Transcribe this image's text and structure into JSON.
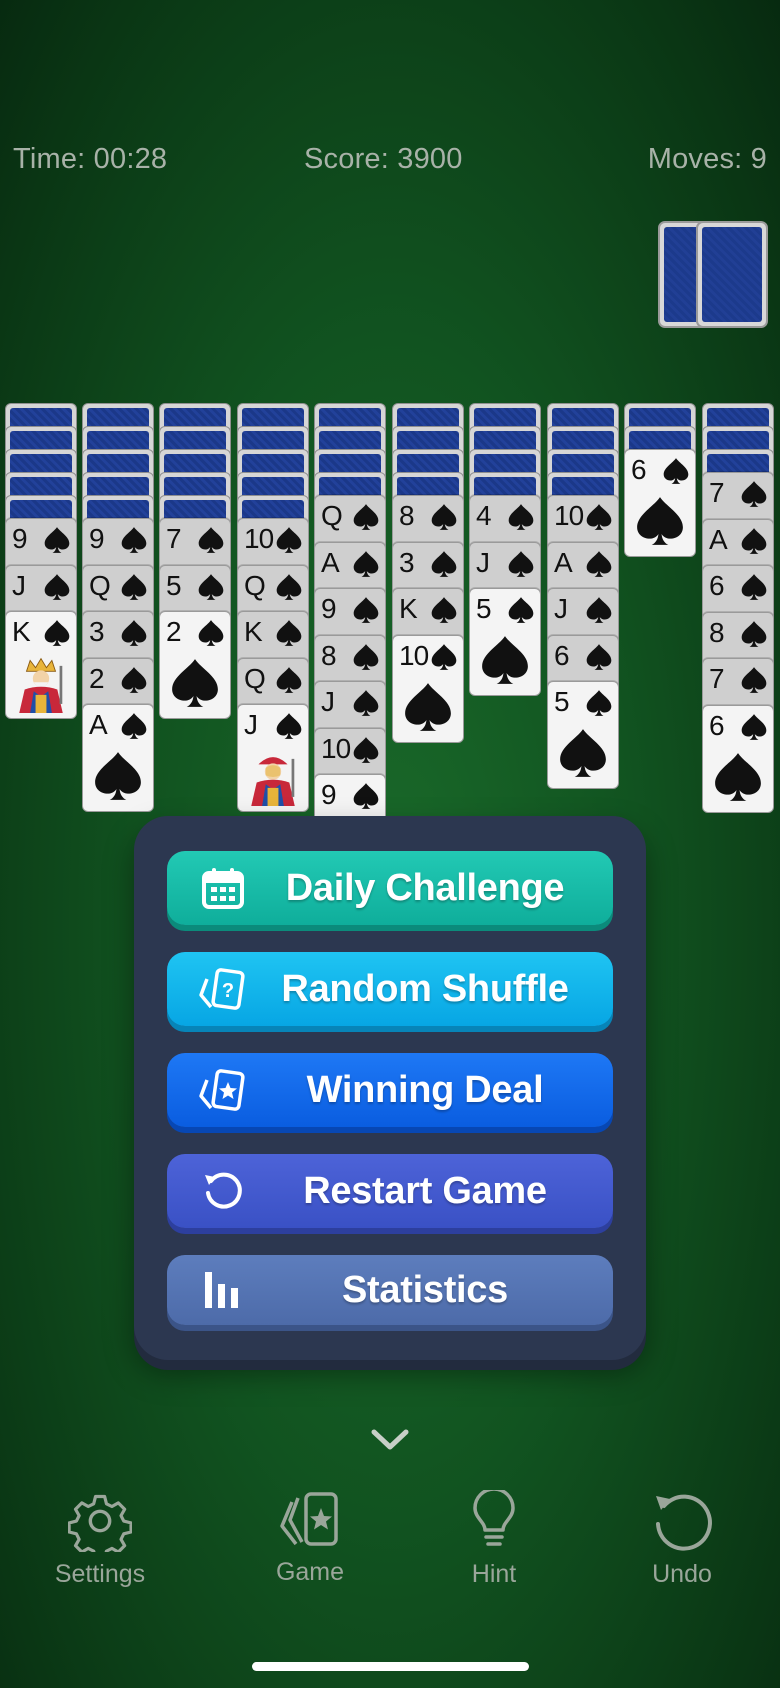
{
  "stats": {
    "time": "Time: 00:28",
    "score": "Score: 3900",
    "moves": "Moves: 9"
  },
  "tableau": [
    {
      "down": 5,
      "up": [
        {
          "rank": "9"
        },
        {
          "rank": "J"
        },
        {
          "rank": "K",
          "face": "king"
        }
      ]
    },
    {
      "down": 5,
      "up": [
        {
          "rank": "9"
        },
        {
          "rank": "Q"
        },
        {
          "rank": "3"
        },
        {
          "rank": "2"
        },
        {
          "rank": "A"
        }
      ]
    },
    {
      "down": 5,
      "up": [
        {
          "rank": "7"
        },
        {
          "rank": "5"
        },
        {
          "rank": "2"
        }
      ]
    },
    {
      "down": 5,
      "up": [
        {
          "rank": "10"
        },
        {
          "rank": "Q"
        },
        {
          "rank": "K"
        },
        {
          "rank": "Q"
        },
        {
          "rank": "J",
          "face": "jack"
        }
      ]
    },
    {
      "down": 4,
      "up": [
        {
          "rank": "Q"
        },
        {
          "rank": "A"
        },
        {
          "rank": "9"
        },
        {
          "rank": "8"
        },
        {
          "rank": "J"
        },
        {
          "rank": "10"
        },
        {
          "rank": "9"
        }
      ]
    },
    {
      "down": 4,
      "up": [
        {
          "rank": "8"
        },
        {
          "rank": "3"
        },
        {
          "rank": "K"
        },
        {
          "rank": "10"
        }
      ]
    },
    {
      "down": 4,
      "up": [
        {
          "rank": "4"
        },
        {
          "rank": "J"
        },
        {
          "rank": "5"
        }
      ]
    },
    {
      "down": 4,
      "up": [
        {
          "rank": "10"
        },
        {
          "rank": "A"
        },
        {
          "rank": "J"
        },
        {
          "rank": "6"
        },
        {
          "rank": "5"
        }
      ]
    },
    {
      "down": 2,
      "up": [
        {
          "rank": "6"
        }
      ]
    },
    {
      "down": 3,
      "up": [
        {
          "rank": "7"
        },
        {
          "rank": "A"
        },
        {
          "rank": "6"
        },
        {
          "rank": "8"
        },
        {
          "rank": "7"
        },
        {
          "rank": "6"
        }
      ]
    }
  ],
  "menu": {
    "daily": "Daily Challenge",
    "random": "Random Shuffle",
    "winning": "Winning Deal",
    "restart": "Restart Game",
    "stats": "Statistics"
  },
  "tabs": {
    "settings": "Settings",
    "game": "Game",
    "hint": "Hint",
    "undo": "Undo"
  },
  "colors": {
    "felt": "#115320",
    "menu_bg": "#2c3750",
    "daily": "#12b3a0",
    "random": "#0aaeea",
    "winning": "#0e63e8",
    "restart": "#4259cc",
    "stats": "#5573b1"
  },
  "icons": {
    "daily": "calendar-icon",
    "random": "question-cards-icon",
    "winning": "star-cards-icon",
    "restart": "restart-icon",
    "stats": "bar-chart-icon"
  }
}
